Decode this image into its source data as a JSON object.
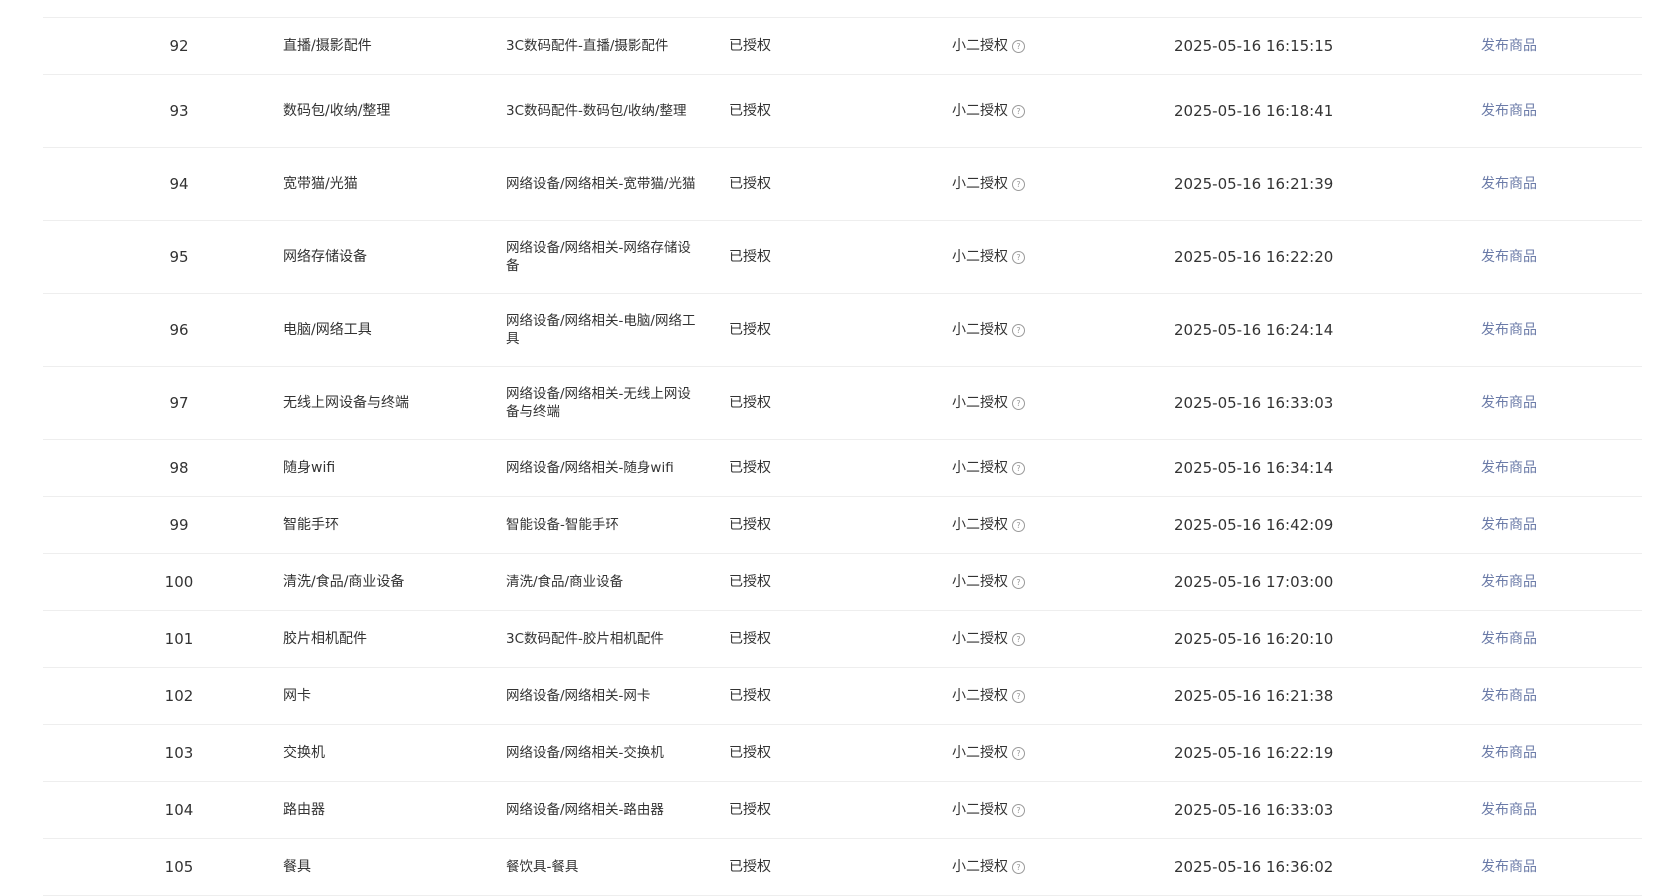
{
  "help_icon_glyph": "?",
  "accent_link_color": "#6b7ba8",
  "rows": [
    {
      "index": "92",
      "name": "直播/摄影配件",
      "path": "3C数码配件-直播/摄影配件",
      "status": "已授权",
      "auth_type": "小二授权",
      "time": "2025-05-16 16:15:15",
      "action": "发布商品"
    },
    {
      "index": "93",
      "name": "数码包/收纳/整理",
      "path": "3C数码配件-数码包/收纳/整理",
      "status": "已授权",
      "auth_type": "小二授权",
      "time": "2025-05-16 16:18:41",
      "action": "发布商品"
    },
    {
      "index": "94",
      "name": "宽带猫/光猫",
      "path": "网络设备/网络相关-宽带猫/光猫",
      "status": "已授权",
      "auth_type": "小二授权",
      "time": "2025-05-16 16:21:39",
      "action": "发布商品"
    },
    {
      "index": "95",
      "name": "网络存储设备",
      "path": "网络设备/网络相关-网络存储设备",
      "status": "已授权",
      "auth_type": "小二授权",
      "time": "2025-05-16 16:22:20",
      "action": "发布商品"
    },
    {
      "index": "96",
      "name": "电脑/网络工具",
      "path": "网络设备/网络相关-电脑/网络工具",
      "status": "已授权",
      "auth_type": "小二授权",
      "time": "2025-05-16 16:24:14",
      "action": "发布商品"
    },
    {
      "index": "97",
      "name": "无线上网设备与终端",
      "path": "网络设备/网络相关-无线上网设备与终端",
      "status": "已授权",
      "auth_type": "小二授权",
      "time": "2025-05-16 16:33:03",
      "action": "发布商品"
    },
    {
      "index": "98",
      "name": "随身wifi",
      "path": "网络设备/网络相关-随身wifi",
      "status": "已授权",
      "auth_type": "小二授权",
      "time": "2025-05-16 16:34:14",
      "action": "发布商品"
    },
    {
      "index": "99",
      "name": "智能手环",
      "path": "智能设备-智能手环",
      "status": "已授权",
      "auth_type": "小二授权",
      "time": "2025-05-16 16:42:09",
      "action": "发布商品"
    },
    {
      "index": "100",
      "name": "清洗/食品/商业设备",
      "path": "清洗/食品/商业设备",
      "status": "已授权",
      "auth_type": "小二授权",
      "time": "2025-05-16 17:03:00",
      "action": "发布商品"
    },
    {
      "index": "101",
      "name": "胶片相机配件",
      "path": "3C数码配件-胶片相机配件",
      "status": "已授权",
      "auth_type": "小二授权",
      "time": "2025-05-16 16:20:10",
      "action": "发布商品"
    },
    {
      "index": "102",
      "name": "网卡",
      "path": "网络设备/网络相关-网卡",
      "status": "已授权",
      "auth_type": "小二授权",
      "time": "2025-05-16 16:21:38",
      "action": "发布商品"
    },
    {
      "index": "103",
      "name": "交换机",
      "path": "网络设备/网络相关-交换机",
      "status": "已授权",
      "auth_type": "小二授权",
      "time": "2025-05-16 16:22:19",
      "action": "发布商品"
    },
    {
      "index": "104",
      "name": "路由器",
      "path": "网络设备/网络相关-路由器",
      "status": "已授权",
      "auth_type": "小二授权",
      "time": "2025-05-16 16:33:03",
      "action": "发布商品"
    },
    {
      "index": "105",
      "name": "餐具",
      "path": "餐饮具-餐具",
      "status": "已授权",
      "auth_type": "小二授权",
      "time": "2025-05-16 16:36:02",
      "action": "发布商品"
    }
  ]
}
